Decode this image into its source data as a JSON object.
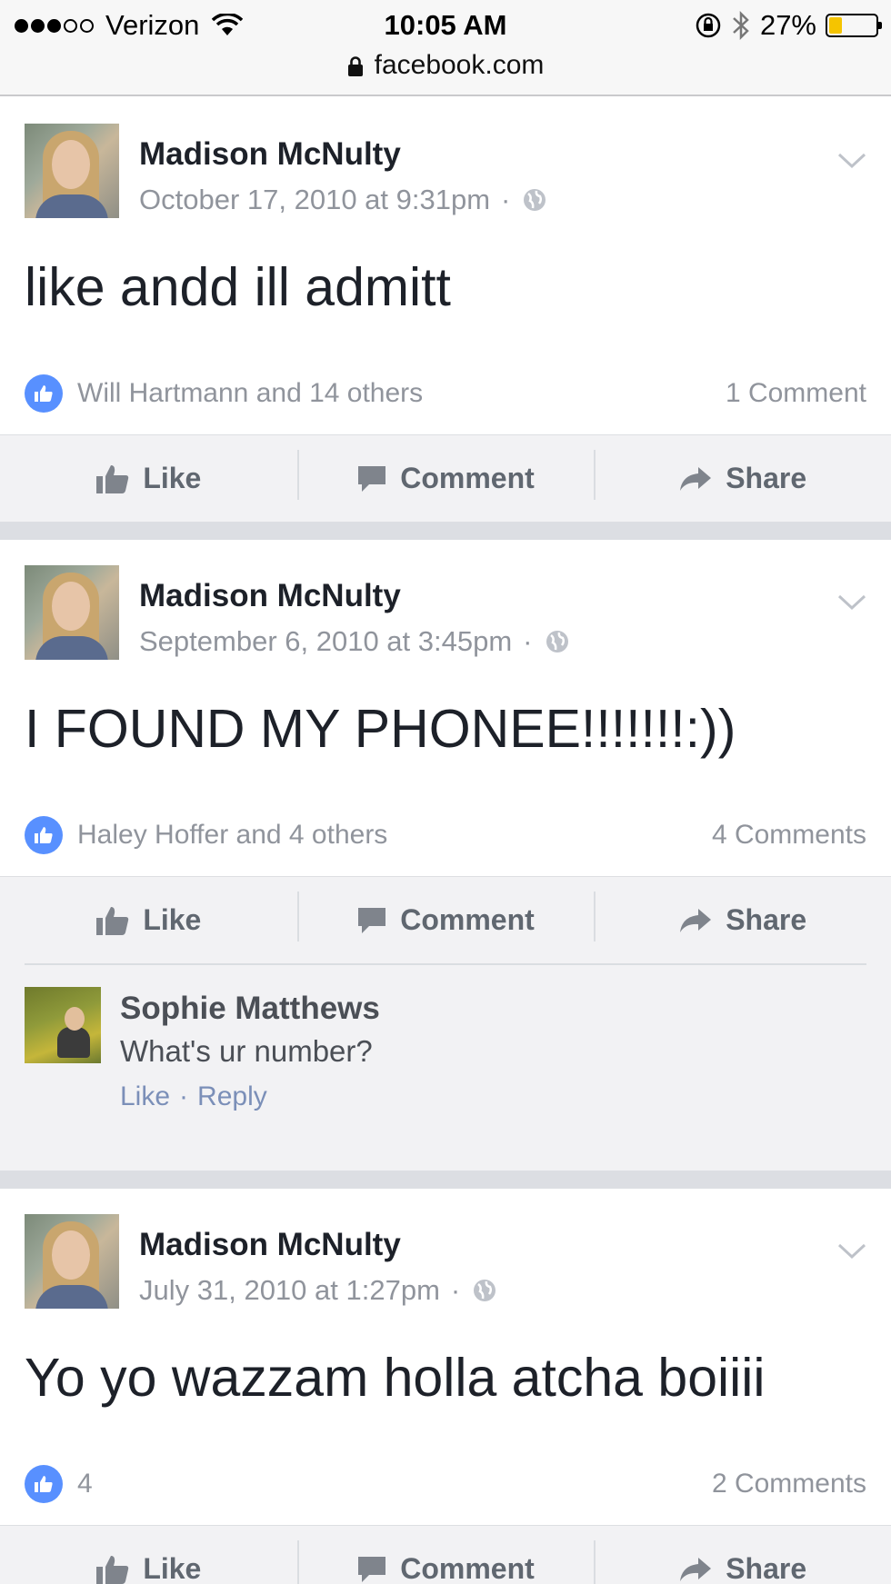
{
  "status_bar": {
    "carrier": "Verizon",
    "time": "10:05 AM",
    "battery_percent": "27%",
    "battery_level": 0.27
  },
  "address_bar": {
    "url": "facebook.com"
  },
  "posts": [
    {
      "author": "Madison McNulty",
      "timestamp": "October 17, 2010 at 9:31pm",
      "meta_sep": "·",
      "text": "like andd ill admitt",
      "likers": "Will Hartmann and 14 others",
      "comment_count": "1 Comment",
      "actions": {
        "like": "Like",
        "comment": "Comment",
        "share": "Share"
      }
    },
    {
      "author": "Madison McNulty",
      "timestamp": "September 6, 2010 at 3:45pm",
      "meta_sep": "·",
      "text": "I FOUND MY PHONEE!!!!!!!:))",
      "likers": "Haley Hoffer and 4 others",
      "comment_count": "4 Comments",
      "actions": {
        "like": "Like",
        "comment": "Comment",
        "share": "Share"
      },
      "comments": [
        {
          "author": "Sophie Matthews",
          "text": "What's ur number?",
          "like": "Like",
          "sep": "·",
          "reply": "Reply"
        }
      ]
    },
    {
      "author": "Madison McNulty",
      "timestamp": "July 31, 2010 at 1:27pm",
      "meta_sep": "·",
      "text": "Yo yo wazzam holla atcha boiiii",
      "likers": "4",
      "comment_count": "2 Comments",
      "actions": {
        "like": "Like",
        "comment": "Comment",
        "share": "Share"
      }
    }
  ],
  "colors": {
    "like_blue": "#5890ff",
    "meta_gray": "#90949c",
    "link_blue": "#7b8fb8",
    "battery_yellow": "#f5c400"
  },
  "icons": [
    "signal-dots-icon",
    "wifi-icon",
    "orientation-lock-icon",
    "bluetooth-icon",
    "battery-icon",
    "lock-icon",
    "globe-icon",
    "chevron-down-icon",
    "like-badge-icon",
    "thumbs-up-icon",
    "comment-icon",
    "share-icon"
  ]
}
